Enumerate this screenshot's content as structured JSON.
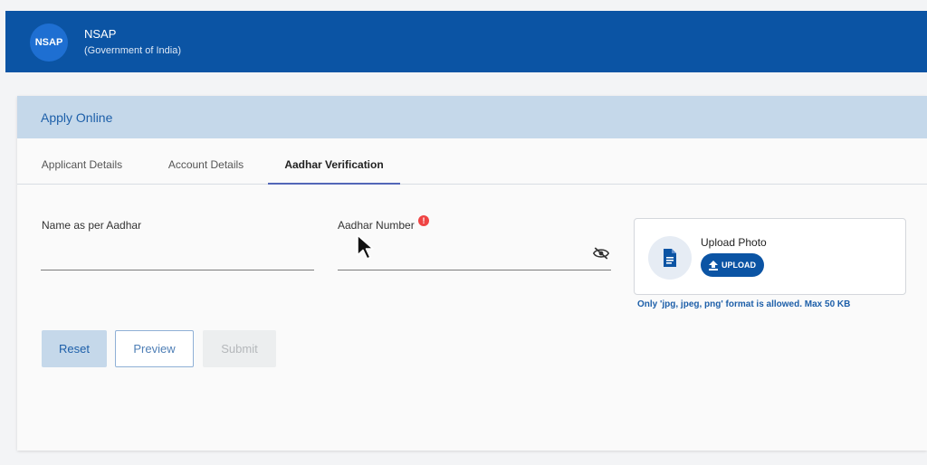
{
  "header": {
    "logo_text": "NSAP",
    "org_name": "NSAP",
    "org_subtitle": "(Government of India)"
  },
  "card": {
    "title": "Apply Online"
  },
  "tabs": [
    {
      "label": "Applicant Details",
      "active": false
    },
    {
      "label": "Account Details",
      "active": false
    },
    {
      "label": "Aadhar Verification",
      "active": true
    }
  ],
  "form": {
    "name_label": "Name as per Aadhar",
    "name_value": "",
    "aadhar_label": "Aadhar Number",
    "aadhar_error_mark": "!",
    "aadhar_value": ""
  },
  "upload": {
    "title": "Upload Photo",
    "button_label": "UPLOAD",
    "hint": "Only 'jpg, jpeg, png' format is allowed. Max 50 KB"
  },
  "buttons": {
    "reset": "Reset",
    "preview": "Preview",
    "submit": "Submit"
  },
  "colors": {
    "header_bg": "#0b54a4",
    "card_header_bg": "#c5d8ea",
    "accent": "#1d5fa9",
    "error": "#ef4444"
  }
}
